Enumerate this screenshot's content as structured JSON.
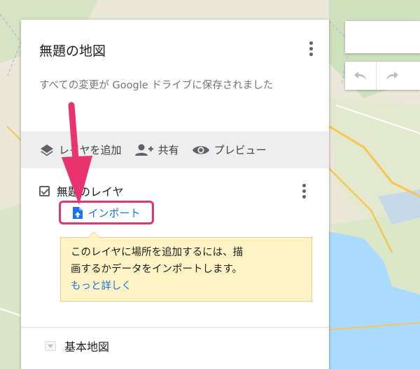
{
  "map_title": "無題の地図",
  "save_status": "すべての変更が Google ドライブに保存されました",
  "toolbar": {
    "add_layer": "レイヤを追加",
    "share": "共有",
    "preview": "プレビュー"
  },
  "layer": {
    "name": "無題のレイヤ",
    "checked": true,
    "import_label": "インポート"
  },
  "tooltip": {
    "line1": "このレイヤに場所を追加するには、描",
    "line2": "画するかデータをインポートします。",
    "link": "もっと詳しく"
  },
  "base_map": {
    "label": "基本地図"
  },
  "icons": {
    "layers": "layers-icon",
    "share": "person-add-icon",
    "preview": "eye-icon",
    "import": "file-upload-icon",
    "undo": "undo-icon",
    "redo": "redo-icon",
    "more": "more-vert-icon",
    "expand": "triangle-down-icon"
  },
  "colors": {
    "annotation": "#e8336e",
    "link": "#1a73e8",
    "tooltip_bg": "#fdf3c4"
  }
}
